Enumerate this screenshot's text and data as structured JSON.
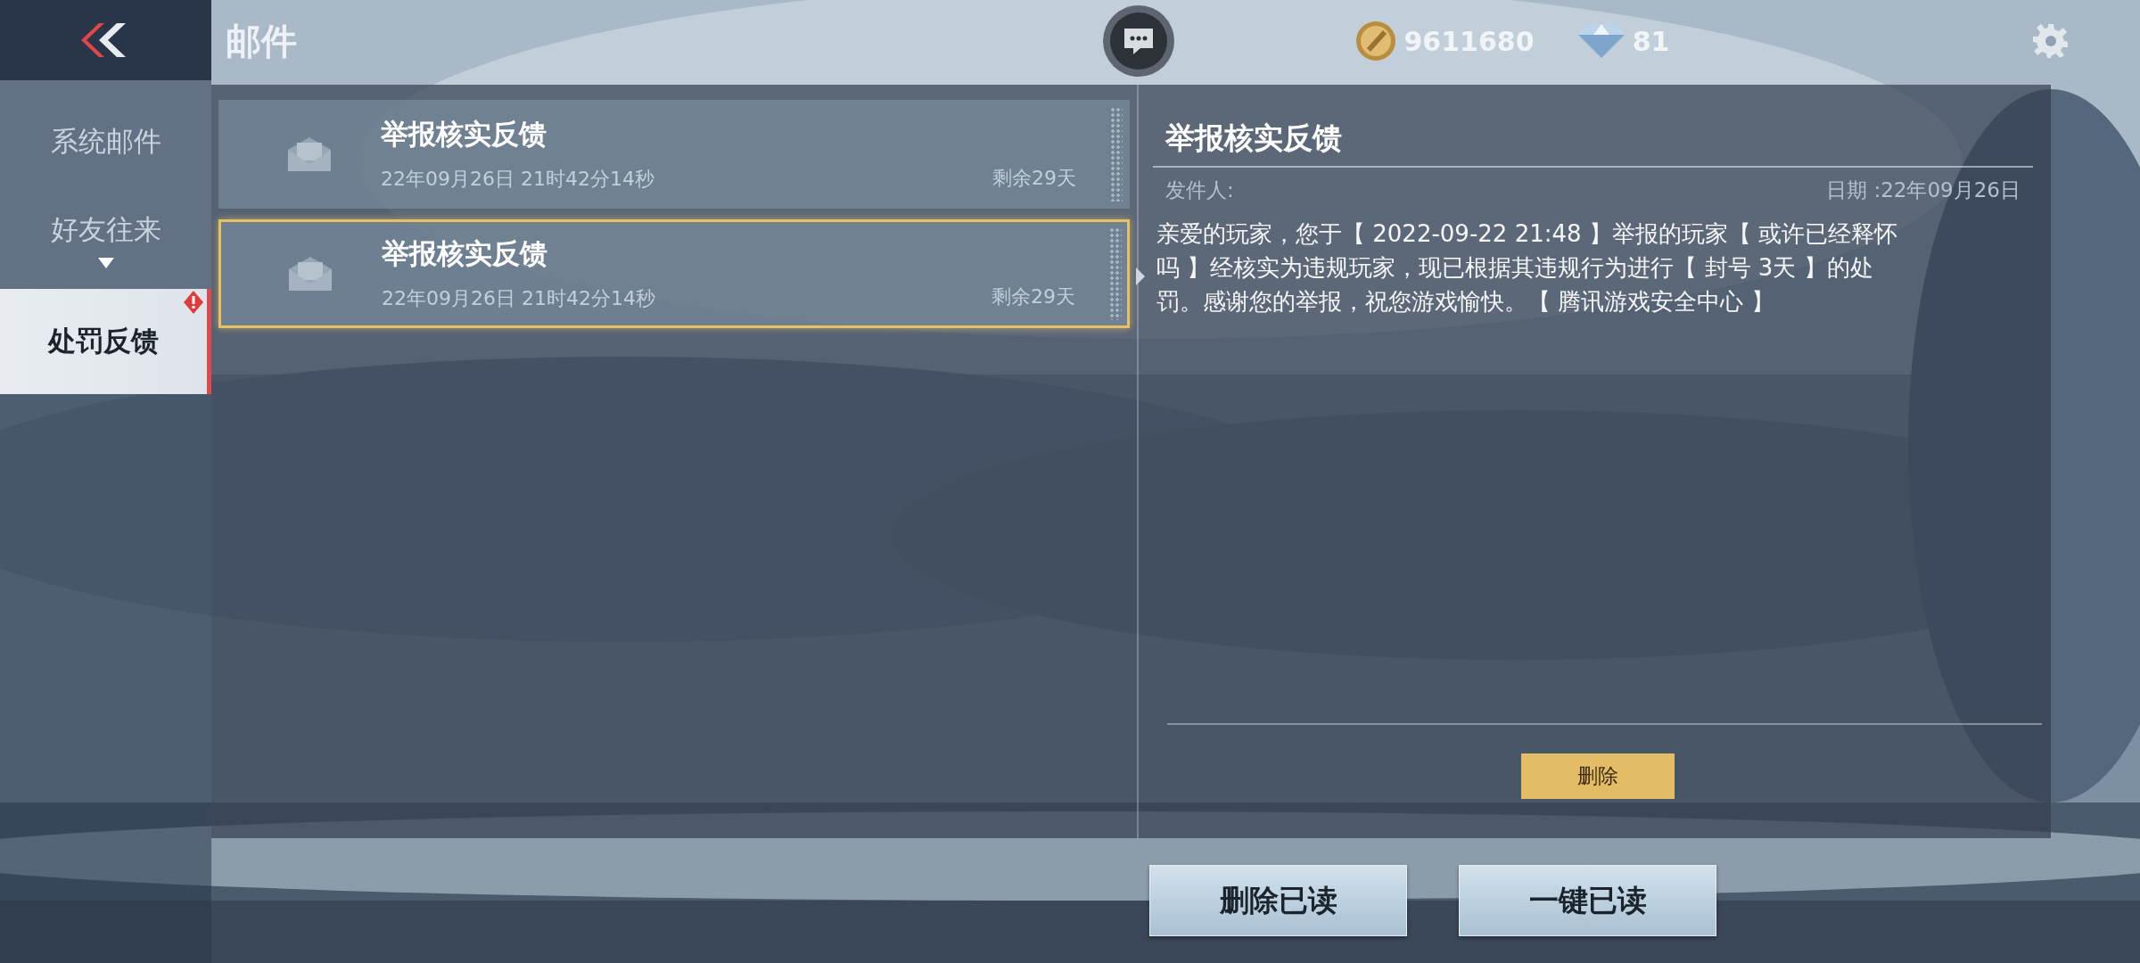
{
  "header": {
    "title": "邮件",
    "coins": "9611680",
    "diamonds": "81"
  },
  "sidebar": {
    "items": [
      {
        "label": "系统邮件",
        "selected": false,
        "expandable": false,
        "alert": false
      },
      {
        "label": "好友往来",
        "selected": false,
        "expandable": true,
        "alert": false
      },
      {
        "label": "处罚反馈",
        "selected": true,
        "expandable": false,
        "alert": true
      }
    ]
  },
  "mails": [
    {
      "title": "举报核实反馈",
      "time": "22年09月26日 21时42分14秒",
      "remaining": "剩余29天",
      "selected": false
    },
    {
      "title": "举报核实反馈",
      "time": "22年09月26日 21时42分14秒",
      "remaining": "剩余29天",
      "selected": true
    }
  ],
  "detail": {
    "title": "举报核实反馈",
    "sender_label": "发件人:",
    "date": "日期 :22年09月26日",
    "body": "亲爱的玩家，您于【 2022-09-22 21:48 】举报的玩家【 或许已经释怀吗 】经核实为违规玩家，现已根据其违规行为进行【 封号 3天 】的处罚。感谢您的举报，祝您游戏愉快。【 腾讯游戏安全中心 】",
    "delete_button": "删除"
  },
  "buttons": [
    "删除已读",
    "一键已读"
  ]
}
